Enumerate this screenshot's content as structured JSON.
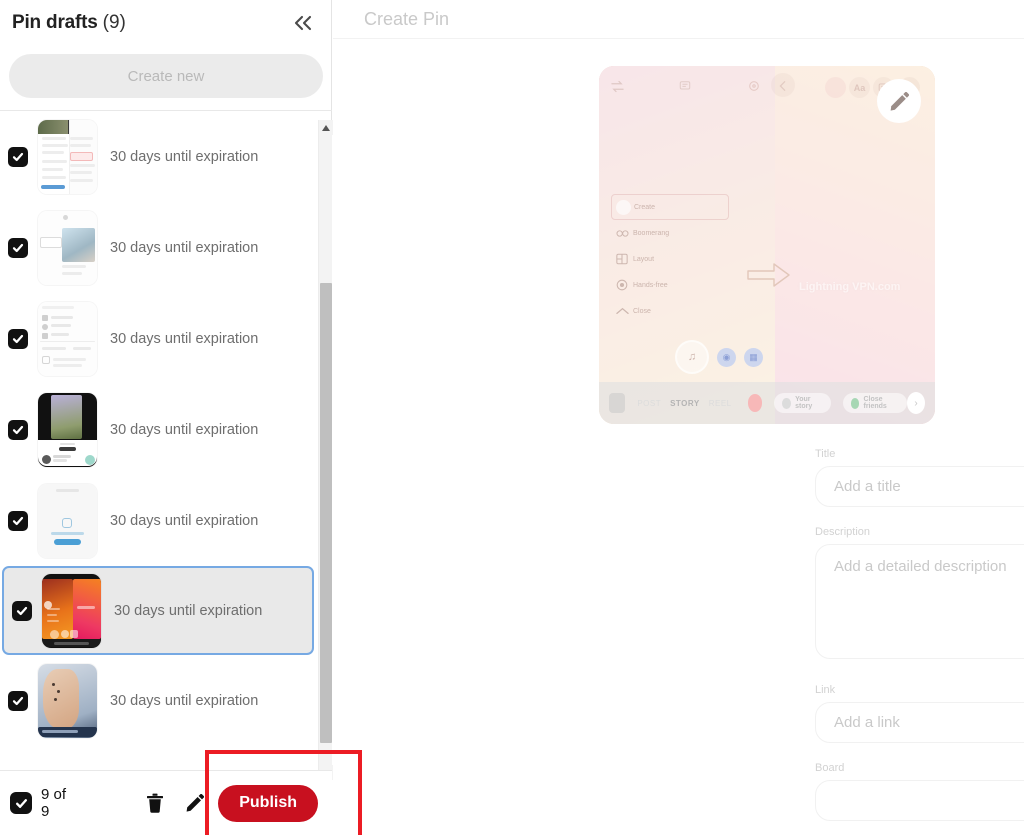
{
  "left_panel": {
    "title": "Pin drafts",
    "count_label": "(9)",
    "collapse_icon": "chevron-double-left-icon",
    "create_new_label": "Create new",
    "drafts": [
      {
        "label": "30 days until expiration",
        "checked": true,
        "selected": false,
        "thumb": "settings-list"
      },
      {
        "label": "30 days until expiration",
        "checked": true,
        "selected": false,
        "thumb": "room-photo"
      },
      {
        "label": "30 days until expiration",
        "checked": true,
        "selected": false,
        "thumb": "menu-list"
      },
      {
        "label": "30 days until expiration",
        "checked": true,
        "selected": false,
        "thumb": "flowers-dark"
      },
      {
        "label": "30 days until expiration",
        "checked": true,
        "selected": false,
        "thumb": "blank-upload"
      },
      {
        "label": "30 days until expiration",
        "checked": true,
        "selected": true,
        "thumb": "orange-story"
      },
      {
        "label": "30 days until expiration",
        "checked": true,
        "selected": false,
        "thumb": "arm-tattoo"
      }
    ],
    "scrollbar": {
      "up_icon": "triangle-up-icon",
      "down_icon": "triangle-down-icon"
    },
    "bottom_bar": {
      "select_all_checked": true,
      "select_count": "9 of 9",
      "trash_icon": "trash-icon",
      "edit_icon": "pencil-icon",
      "publish_label": "Publish",
      "publish_color": "#c8101f"
    },
    "annotation": {
      "shape": "rectangle",
      "color": "#ec1c24"
    }
  },
  "right_panel": {
    "header_title": "Create Pin",
    "preview": {
      "pencil_icon": "pencil-edit-icon",
      "watermark": "Lightning VPN.com",
      "menu_items": [
        {
          "label": "Create",
          "icon": "create-icon",
          "active": true
        },
        {
          "label": "Boomerang",
          "icon": "boomerang-icon",
          "active": false
        },
        {
          "label": "Layout",
          "icon": "layout-icon",
          "active": false
        },
        {
          "label": "Hands-free",
          "icon": "hands-free-icon",
          "active": false
        },
        {
          "label": "Close",
          "icon": "chevron-up-icon",
          "active": false
        }
      ],
      "modes": [
        {
          "label": "POST",
          "active": false
        },
        {
          "label": "STORY",
          "active": true
        },
        {
          "label": "REEL",
          "active": false
        }
      ],
      "chips": [
        {
          "label": "Your story",
          "style": "default"
        },
        {
          "label": "Close friends",
          "style": "green"
        }
      ],
      "next_icon": "chevron-right-icon",
      "topbar_icons": [
        "swap-camera-icon",
        "sticker-icon",
        "settings-icon",
        "back-icon",
        "filter-icon",
        "text-icon",
        "sticker2-icon",
        "more-icon"
      ]
    },
    "form": {
      "title": {
        "label": "Title",
        "value": "",
        "placeholder": "Add a title"
      },
      "description": {
        "label": "Description",
        "value": "",
        "placeholder": "Add a detailed description"
      },
      "link": {
        "label": "Link",
        "value": "",
        "placeholder": "Add a link"
      },
      "board": {
        "label": "Board",
        "value": "",
        "placeholder": ""
      }
    }
  }
}
